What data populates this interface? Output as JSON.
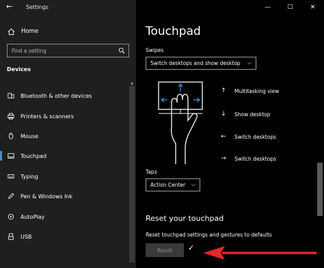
{
  "window": {
    "title": "Settings",
    "controls": {
      "minimize": "—",
      "maximize": "☐",
      "close": "✕"
    }
  },
  "sidebar": {
    "home_label": "Home",
    "search_placeholder": "Find a setting",
    "section_title": "Devices",
    "items": [
      {
        "label": "Bluetooth & other devices",
        "icon": "bluetooth-icon"
      },
      {
        "label": "Printers & scanners",
        "icon": "printer-icon"
      },
      {
        "label": "Mouse",
        "icon": "mouse-icon"
      },
      {
        "label": "Touchpad",
        "icon": "touchpad-icon",
        "selected": true
      },
      {
        "label": "Typing",
        "icon": "keyboard-icon"
      },
      {
        "label": "Pen & Windows Ink",
        "icon": "pen-icon"
      },
      {
        "label": "AutoPlay",
        "icon": "autoplay-icon"
      },
      {
        "label": "USB",
        "icon": "usb-icon"
      }
    ]
  },
  "main": {
    "title": "Touchpad",
    "swipes": {
      "label": "Swipes",
      "value": "Switch desktops and show desktop"
    },
    "gestures": [
      {
        "arrow": "↑",
        "label": "Multitasking view"
      },
      {
        "arrow": "↓",
        "label": "Show desktop"
      },
      {
        "arrow": "←",
        "label": "Switch desktops"
      },
      {
        "arrow": "→",
        "label": "Switch desktops"
      }
    ],
    "taps": {
      "label": "Taps",
      "value": "Action Center"
    },
    "reset": {
      "title": "Reset your touchpad",
      "description": "Reset touchpad settings and gestures to defaults",
      "button_label": "Reset",
      "done_mark": "✓"
    }
  },
  "colors": {
    "accent": "#3b8fe0",
    "sidebar_bg": "#1f1f1f",
    "main_bg": "#000000",
    "annotation_arrow": "#e8262c"
  }
}
